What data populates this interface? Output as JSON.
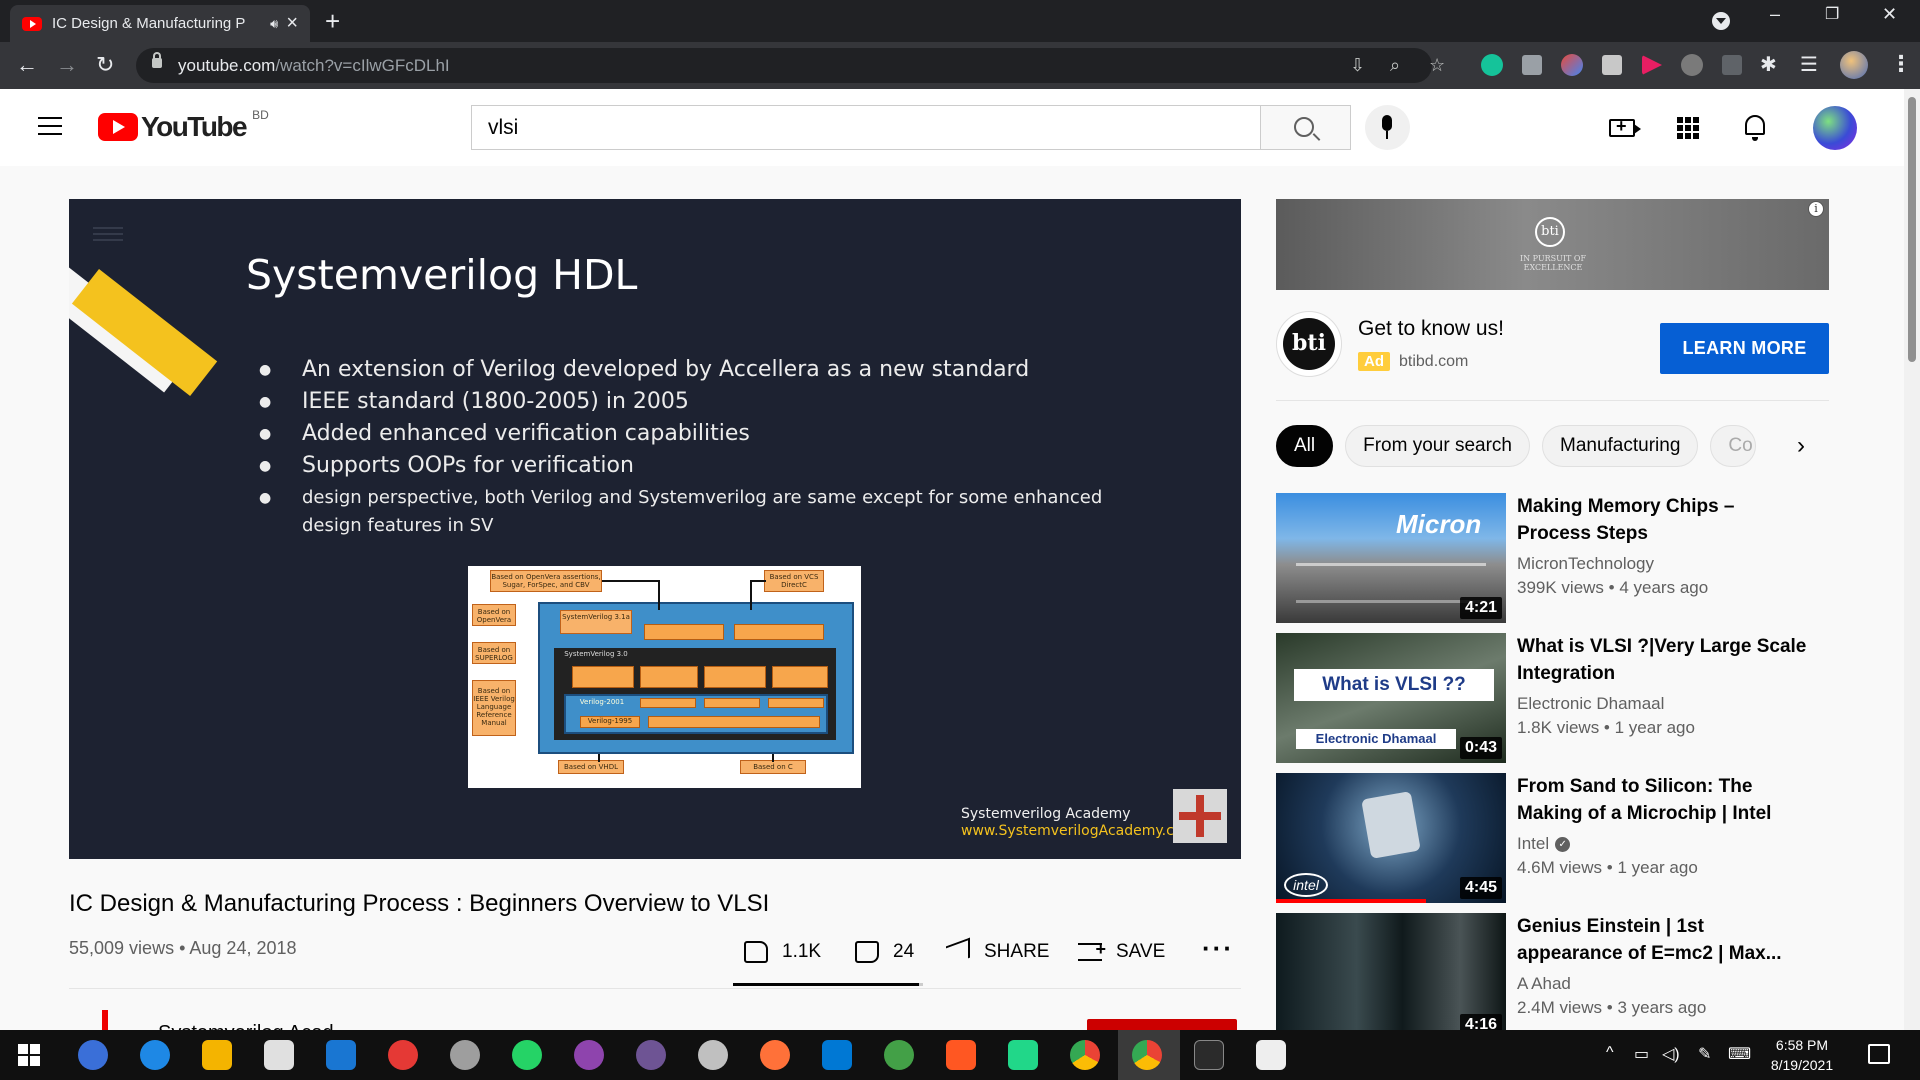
{
  "browser": {
    "tab_title": "IC Design & Manufacturing P",
    "new_tab": "+",
    "url_host": "youtube.com",
    "url_path": "/watch?v=cIlwGFcDLhI",
    "window_controls": [
      "–",
      "❐",
      "✕"
    ]
  },
  "header": {
    "logo_text": "YouTube",
    "country_code": "BD",
    "search_value": "vlsi"
  },
  "slide": {
    "title": "Systemverilog HDL",
    "bullets": [
      "An extension of Verilog developed by Accellera as a new standard",
      "IEEE standard (1800-2005) in 2005",
      "Added enhanced verification capabilities",
      "Supports  OOPs for verification",
      "design perspective, both Verilog and Systemverilog are same except for some enhanced design features in SV"
    ],
    "diagram_labels": {
      "openvera_assert": "Based on OpenVera assertions, Sugar, ForSpec, and CBV",
      "vcs": "Based on VCS DirectC",
      "openvera": "Based on OpenVera",
      "superlog": "Based on SUPERLOG",
      "ieee_manual": "Based on IEEE Verilog Language Reference Manual",
      "sv31": "SystemVerilog 3.1a",
      "sv30": "SystemVerilog 3.0",
      "v2001": "Verilog-2001",
      "v1995": "Verilog-1995",
      "vhdl": "Based on VHDL",
      "c": "Based on C"
    },
    "academy_name": "Systemverilog Academy",
    "academy_url": "www.SystemverilogAcademy.com"
  },
  "video": {
    "title": "IC Design & Manufacturing Process : Beginners Overview to VLSI",
    "views": "55,009 views",
    "date": "Aug 24, 2018",
    "likes": "1.1K",
    "dislikes": "24",
    "like_ratio": 0.98,
    "share_label": "SHARE",
    "save_label": "SAVE",
    "channel_peek": "Systemverilog Acad"
  },
  "ad": {
    "title": "Get to know us!",
    "badge": "Ad",
    "domain": "btibd.com",
    "cta": "LEARN MORE",
    "banner_tagline": "IN PURSUIT OF EXCELLENCE",
    "logo_text": "bti"
  },
  "chips": [
    "All",
    "From your search",
    "Manufacturing",
    "Co"
  ],
  "recommendations": [
    {
      "title": "Making Memory Chips – Process Steps",
      "channel": "MicronTechnology",
      "views": "399K views",
      "age": "4 years ago",
      "duration": "4:21",
      "thumb_text": "Micron",
      "verified": false
    },
    {
      "title": "What is VLSI ?|Very Large Scale Integration",
      "channel": "Electronic Dhamaal",
      "views": "1.8K views",
      "age": "1 year ago",
      "duration": "0:43",
      "thumb_text": "What is VLSI ??",
      "thumb_sub": "Electronic Dhamaal",
      "verified": false
    },
    {
      "title": "From Sand to Silicon: The Making of a Microchip | Intel",
      "channel": "Intel",
      "views": "4.6M views",
      "age": "1 year ago",
      "duration": "4:45",
      "thumb_text": "intel",
      "verified": true,
      "watched": 0.65
    },
    {
      "title": "Genius Einstein | 1st appearance of E=mc2 | Max...",
      "channel": "A Ahad",
      "views": "2.4M views",
      "age": "3 years ago",
      "duration": "4:16",
      "verified": false
    }
  ],
  "taskbar": {
    "time": "6:58 PM",
    "date": "8/19/2021"
  }
}
